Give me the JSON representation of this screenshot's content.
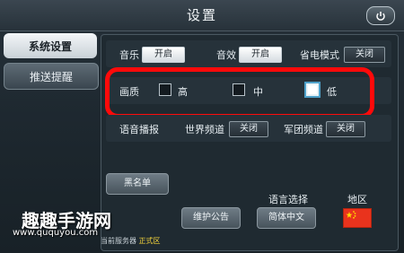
{
  "window": {
    "title": "设置"
  },
  "tabs": [
    {
      "label": "系统设置",
      "active": true
    },
    {
      "label": "推送提醒",
      "active": false
    }
  ],
  "sound_row": {
    "music_label": "音乐",
    "music_value": "开启",
    "sfx_label": "音效",
    "sfx_value": "开启",
    "power_label": "省电模式",
    "power_value": "关闭"
  },
  "quality_row": {
    "label": "画质",
    "options": [
      {
        "label": "高",
        "checked": false
      },
      {
        "label": "中",
        "checked": false
      },
      {
        "label": "低",
        "checked": true
      }
    ]
  },
  "voice_row": {
    "label": "语音播报",
    "world_label": "世界频道",
    "world_value": "关闭",
    "legion_label": "军团频道",
    "legion_value": "关闭"
  },
  "bottom": {
    "blacklist": "黑名单",
    "notice": "维护公告",
    "language_title": "语言选择",
    "language_value": "简体中文",
    "region_title": "地区",
    "server_label": "当前服务器",
    "server_value": "正式区"
  },
  "watermark": {
    "title": "趣趣手游网",
    "url": "www.ququyou.com"
  },
  "colors": {
    "highlight_ring": "#ff0a0a",
    "accent": "#4ea0c8",
    "flag": "#e9331d"
  }
}
